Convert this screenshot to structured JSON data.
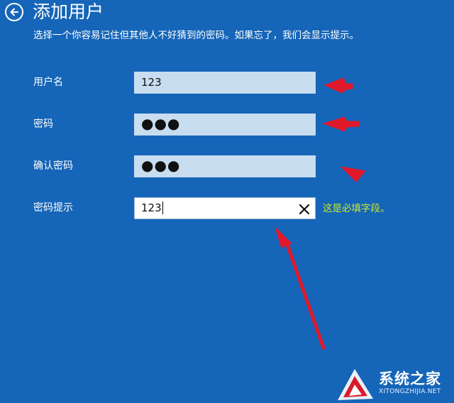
{
  "header": {
    "title": "添加用户",
    "subtitle": "选择一个你容易记住但其他人不好猜到的密码。如果忘了，我们会显示提示。"
  },
  "form": {
    "username": {
      "label": "用户名",
      "value": "123"
    },
    "password": {
      "label": "密码",
      "value": "●●●"
    },
    "confirm": {
      "label": "确认密码",
      "value": "●●●"
    },
    "hint": {
      "label": "密码提示",
      "value": "123",
      "validation": "这是必填字段。"
    }
  },
  "watermark": {
    "name": "系统之家",
    "url": "XITONGZHIJIA.NET"
  },
  "colors": {
    "background": "#1565b8",
    "field_fill": "#c8ddef",
    "validation_text": "#c8e82a",
    "annotation_arrow": "#e0192a"
  }
}
